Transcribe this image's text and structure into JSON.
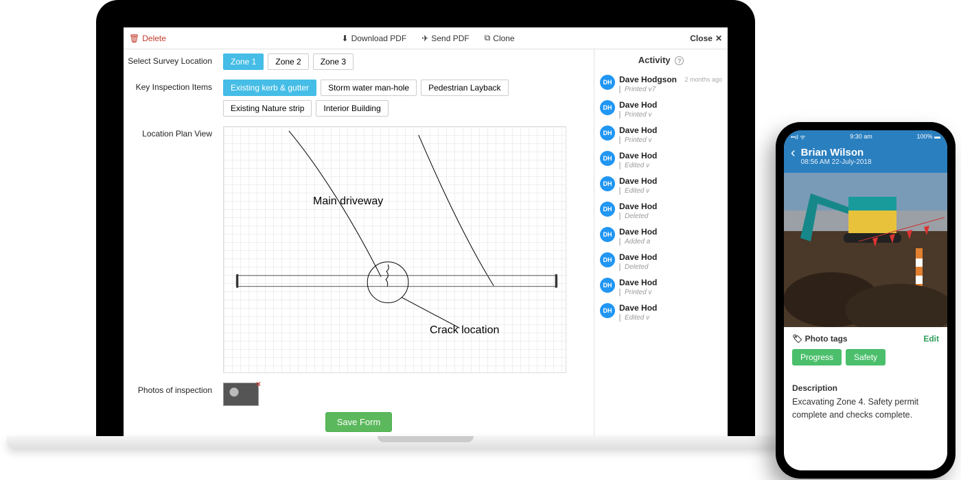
{
  "toolbar": {
    "delete": "Delete",
    "download": "Download PDF",
    "send": "Send PDF",
    "clone": "Clone",
    "close": "Close"
  },
  "survey": {
    "label": "Select Survey Location",
    "zones": [
      "Zone 1",
      "Zone 2",
      "Zone 3"
    ],
    "active_index": 0
  },
  "inspection": {
    "label": "Key Inspection Items",
    "items": [
      "Existing kerb & gutter",
      "Storm water man-hole",
      "Pedestrian Layback",
      "Existing Nature strip",
      "Interior Building"
    ],
    "active_index": 0
  },
  "plan": {
    "label": "Location Plan View",
    "annotations": {
      "driveway": "Main driveway",
      "crack": "Crack location"
    }
  },
  "photos": {
    "label": "Photos of inspection"
  },
  "save_label": "Save Form",
  "activity": {
    "header": "Activity",
    "items": [
      {
        "initials": "DH",
        "name": "Dave Hodgson",
        "action": "Printed v7",
        "time": "2 months ago"
      },
      {
        "initials": "DH",
        "name": "Dave Hod",
        "action": "Printed v"
      },
      {
        "initials": "DH",
        "name": "Dave Hod",
        "action": "Printed v"
      },
      {
        "initials": "DH",
        "name": "Dave Hod",
        "action": "Edited v"
      },
      {
        "initials": "DH",
        "name": "Dave Hod",
        "action": "Edited v"
      },
      {
        "initials": "DH",
        "name": "Dave Hod",
        "action": "Deleted"
      },
      {
        "initials": "DH",
        "name": "Dave Hod",
        "action": "Added a"
      },
      {
        "initials": "DH",
        "name": "Dave Hod",
        "action": "Deleted"
      },
      {
        "initials": "DH",
        "name": "Dave Hod",
        "action": "Printed v"
      },
      {
        "initials": "DH",
        "name": "Dave Hod",
        "action": "Edited v"
      }
    ]
  },
  "phone": {
    "statusbar": {
      "time": "9:30 am",
      "battery": "100%"
    },
    "title": "Brian Wilson",
    "subtitle": "08:56 AM 22-July-2018",
    "tags_label": "Photo tags",
    "edit_label": "Edit",
    "tags": [
      "Progress",
      "Safety"
    ],
    "desc_label": "Description",
    "desc": "Excavating Zone 4. Safety permit complete and checks complete."
  }
}
